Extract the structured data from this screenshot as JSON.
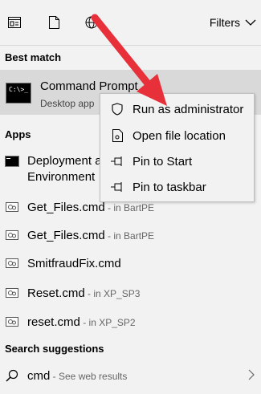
{
  "topbar": {
    "icons": [
      "apps-icon",
      "document-icon",
      "web-icon"
    ],
    "filters_label": "Filters"
  },
  "best_match": {
    "title": "Best match",
    "item": {
      "name": "Command Prompt",
      "type": "Desktop app"
    }
  },
  "context_menu": {
    "items": [
      {
        "label": "Run as administrator",
        "icon": "shield-icon"
      },
      {
        "label": "Open file location",
        "icon": "file-location-icon"
      },
      {
        "label": "Pin to Start",
        "icon": "pin-icon"
      },
      {
        "label": "Pin to taskbar",
        "icon": "pin-icon"
      }
    ]
  },
  "apps": {
    "title": "Apps",
    "items": [
      {
        "name_line1": "Deployment a",
        "name_line2": "Environment",
        "location": ""
      },
      {
        "name": "Get_Files.cmd",
        "location": " - in BartPE"
      },
      {
        "name": "Get_Files.cmd",
        "location": " - in BartPE"
      },
      {
        "name": "SmitfraudFix.cmd",
        "location": ""
      },
      {
        "name": "Reset.cmd",
        "location": " - in XP_SP3"
      },
      {
        "name": "reset.cmd",
        "location": " - in XP_SP2"
      }
    ]
  },
  "search_suggestions": {
    "title": "Search suggestions",
    "item": {
      "query": "cmd",
      "hint": " - See web results"
    }
  },
  "colors": {
    "arrow": "#e8303a",
    "highlight": "#d9d9d9",
    "background": "#f2f2f2"
  }
}
